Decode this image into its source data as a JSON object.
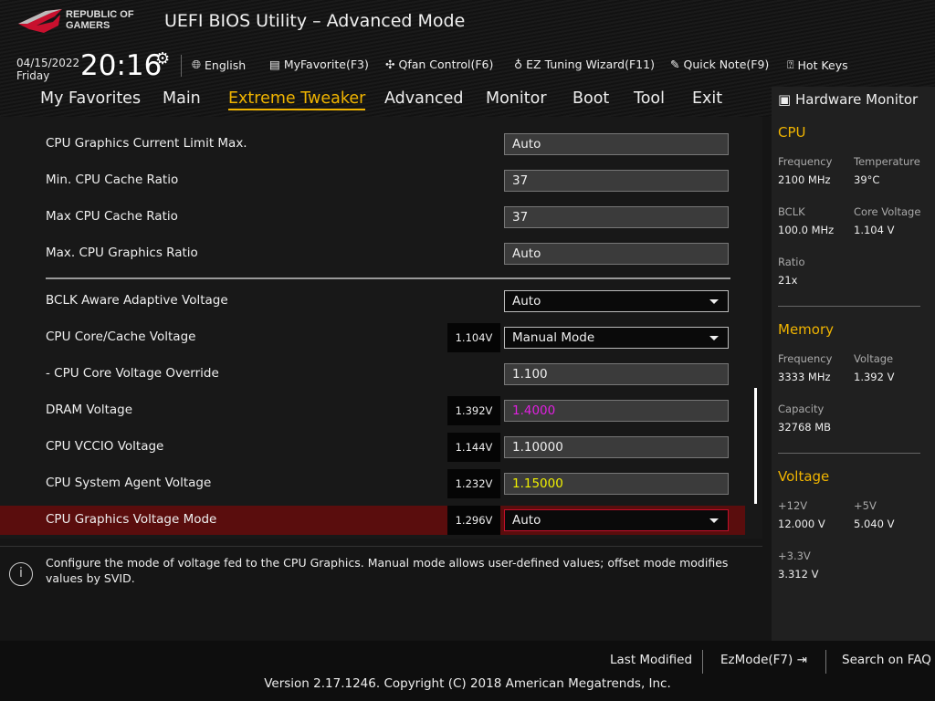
{
  "header": {
    "logo_text": "REPUBLIC OF GAMERS",
    "title": "UEFI BIOS Utility – Advanced Mode",
    "date": "04/15/2022",
    "day": "Friday",
    "time": "20:16"
  },
  "toolbar": {
    "language": "English",
    "myfavorite": "MyFavorite(F3)",
    "qfan": "Qfan Control(F6)",
    "ez_tuning": "EZ Tuning Wizard(F11)",
    "quick_note": "Quick Note(F9)",
    "hot_keys": "Hot Keys"
  },
  "tabs": [
    "My Favorites",
    "Main",
    "Extreme Tweaker",
    "Advanced",
    "Monitor",
    "Boot",
    "Tool",
    "Exit"
  ],
  "settings": [
    {
      "label": "CPU Graphics Current Limit Max.",
      "value": "Auto"
    },
    {
      "label": "Min. CPU Cache Ratio",
      "value": "37"
    },
    {
      "label": "Max CPU Cache Ratio",
      "value": "37"
    },
    {
      "label": "Max. CPU Graphics Ratio",
      "value": "Auto"
    },
    {
      "label": "BCLK Aware Adaptive Voltage",
      "value": "Auto"
    },
    {
      "label": "CPU Core/Cache Voltage",
      "value": "Manual Mode",
      "reading": "1.104V"
    },
    {
      "label": "- CPU Core Voltage Override",
      "value": "1.100"
    },
    {
      "label": "DRAM Voltage",
      "value": "1.4000",
      "reading": "1.392V",
      "color": "#e020e0"
    },
    {
      "label": "CPU VCCIO Voltage",
      "value": "1.10000",
      "reading": "1.144V"
    },
    {
      "label": "CPU System Agent Voltage",
      "value": "1.15000",
      "reading": "1.232V",
      "color": "#f0f000"
    },
    {
      "label": "CPU Graphics Voltage Mode",
      "value": "Auto",
      "reading": "1.296V"
    }
  ],
  "help": "Configure the mode of voltage fed to the CPU Graphics. Manual mode allows user-defined values; offset mode modifies values by SVID.",
  "hw": {
    "title": "Hardware Monitor",
    "cpu": {
      "title": "CPU",
      "freq_k": "Frequency",
      "freq": "2100 MHz",
      "temp_k": "Temperature",
      "temp": "39°C",
      "bclk_k": "BCLK",
      "bclk": "100.0 MHz",
      "cv_k": "Core Voltage",
      "cv": "1.104 V",
      "ratio_k": "Ratio",
      "ratio": "21x"
    },
    "mem": {
      "title": "Memory",
      "freq_k": "Frequency",
      "freq": "3333 MHz",
      "volt_k": "Voltage",
      "volt": "1.392 V",
      "cap_k": "Capacity",
      "cap": "32768 MB"
    },
    "volt": {
      "title": "Voltage",
      "v12_k": "+12V",
      "v12": "12.000 V",
      "v5_k": "+5V",
      "v5": "5.040 V",
      "v33_k": "+3.3V",
      "v33": "3.312 V"
    }
  },
  "footer": {
    "last_modified": "Last Modified",
    "ezmode": "EzMode(F7)",
    "search": "Search on FAQ",
    "version": "Version 2.17.1246. Copyright (C) 2018 American Megatrends, Inc."
  },
  "colors": {
    "accent": "#f0b400",
    "selected_row": "#5a0d0d"
  }
}
